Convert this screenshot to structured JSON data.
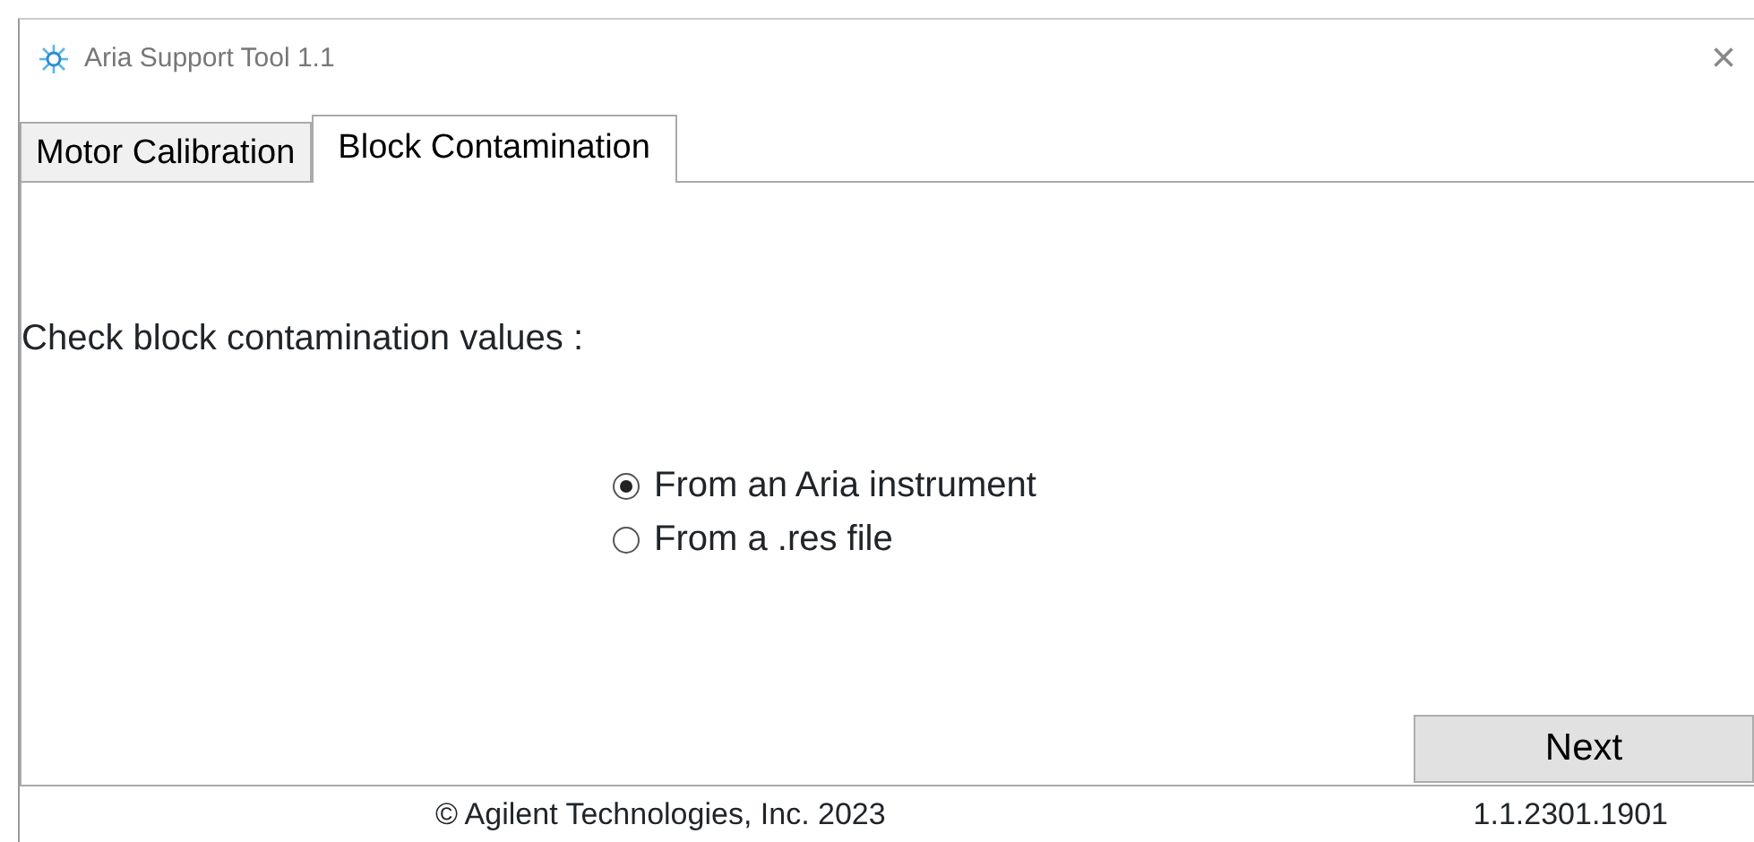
{
  "window": {
    "title": "Aria Support Tool 1.1",
    "close": "×"
  },
  "tabs": [
    {
      "label": "Motor Calibration",
      "selected": false
    },
    {
      "label": "Block Contamination",
      "selected": true
    }
  ],
  "prompt": "Check block contamination values :",
  "options": [
    {
      "label": "From an Aria instrument",
      "selected": true
    },
    {
      "label": "From a .res file",
      "selected": false
    }
  ],
  "next_button": "Next",
  "footer": {
    "copyright": "© Agilent Technologies, Inc. 2023",
    "version": "1.1.2301.1901"
  }
}
